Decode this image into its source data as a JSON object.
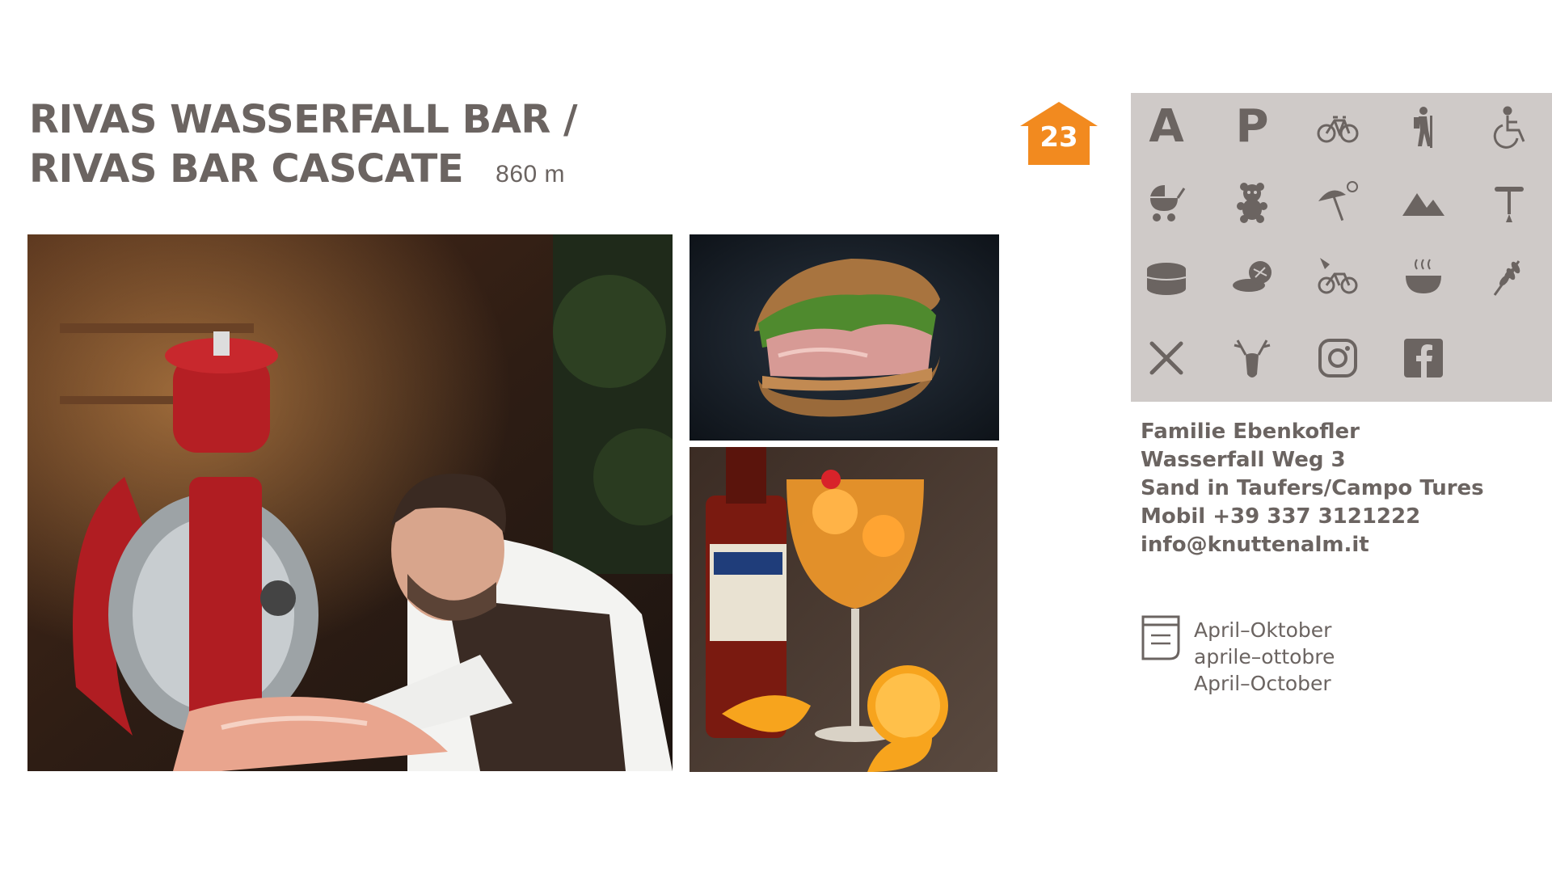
{
  "title": {
    "line1": "RIVAS WASSERFALL BAR /",
    "line2": "RIVAS BAR CASCATE",
    "altitude": "860 m"
  },
  "badge": {
    "number": "23",
    "color": "#f28a1f"
  },
  "colors": {
    "text": "#6b6461",
    "panel": "#cfcac8",
    "accent": "#f28a1f"
  },
  "amenities": [
    "letter-a",
    "letter-p",
    "bicycle-icon",
    "hiker-icon",
    "wheelchair-icon",
    "stroller-icon",
    "teddy-bear-icon",
    "sun-umbrella-icon",
    "mountains-icon",
    "corkscrew-icon",
    "cake-icon",
    "pastry-icon",
    "ebike-icon",
    "soup-bowl-icon",
    "grain-icon",
    "cutlery-icon",
    "deer-icon",
    "instagram-icon",
    "facebook-icon"
  ],
  "amenity_letters": {
    "a": "A",
    "p": "P"
  },
  "contact": {
    "name": "Familie Ebenkofler",
    "street": "Wasserfall Weg 3",
    "town": "Sand in Taufers/Campo Tures",
    "phone": "Mobil  +39 337 3121222",
    "email": "info@knuttenalm.it"
  },
  "season": {
    "de": "April–Oktober",
    "it": "aprile–ottobre",
    "en": "April–October"
  },
  "photos": [
    "bartender-slicer-photo",
    "sandwich-photo",
    "spritz-photo"
  ]
}
